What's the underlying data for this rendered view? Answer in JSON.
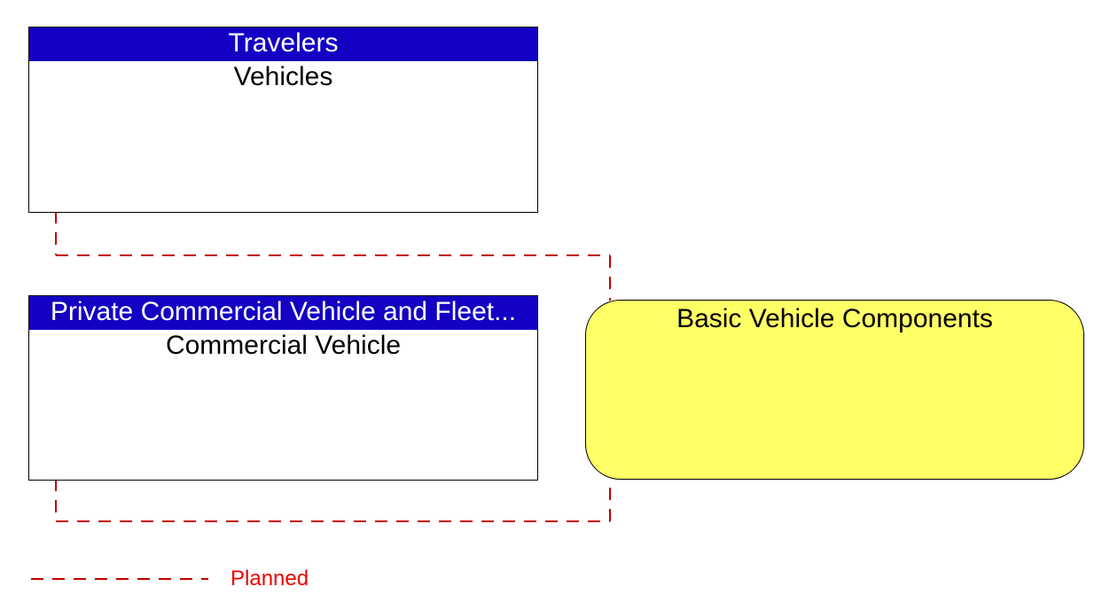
{
  "colors": {
    "header_bg": "#1300c3",
    "bubble_bg": "#ffff66",
    "planned_line": "#c00000",
    "planned_text": "#ee0000"
  },
  "entities": {
    "travelers": {
      "header": "Travelers",
      "body": "Vehicles"
    },
    "commercial": {
      "header": "Private Commercial Vehicle and Fleet...",
      "body": "Commercial Vehicle"
    }
  },
  "bubble": {
    "label": "Basic Vehicle Components"
  },
  "legend": {
    "planned": "Planned"
  }
}
